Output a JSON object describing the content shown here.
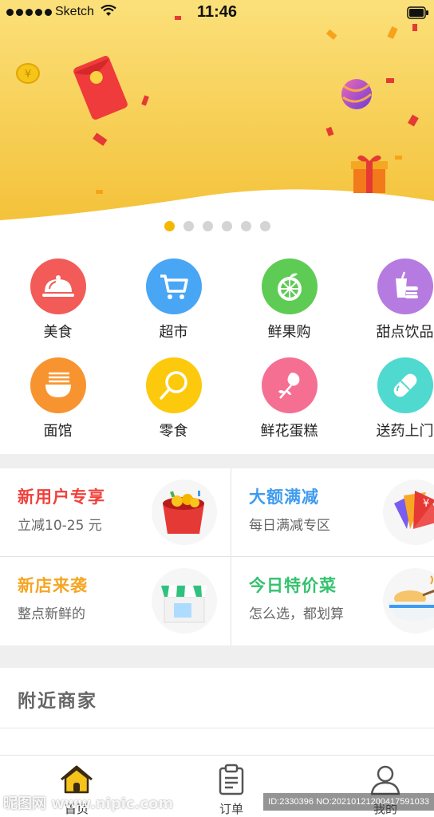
{
  "status_bar": {
    "carrier": "Sketch",
    "time": "11:46"
  },
  "banner": {
    "slide_count": 6,
    "active_index": 0
  },
  "categories": [
    {
      "label": "美食",
      "icon": "food-cloche-icon",
      "color": "#f25b58"
    },
    {
      "label": "超市",
      "icon": "shopping-cart-icon",
      "color": "#48a6f5"
    },
    {
      "label": "鲜果购",
      "icon": "fruit-icon",
      "color": "#5ecb55"
    },
    {
      "label": "甜点饮品",
      "icon": "dessert-drink-icon",
      "color": "#b67be0"
    },
    {
      "label": "面馆",
      "icon": "noodle-bowl-icon",
      "color": "#f7942f"
    },
    {
      "label": "零食",
      "icon": "lollipop-icon",
      "color": "#fcc90d"
    },
    {
      "label": "鲜花蛋糕",
      "icon": "flower-icon",
      "color": "#f56f92"
    },
    {
      "label": "送药上门",
      "icon": "pill-icon",
      "color": "#4fd9cf"
    }
  ],
  "promos": [
    {
      "title": "新用户专享",
      "subtitle": "立减10-25 元",
      "color": "#f0413b",
      "icon": "red-envelope-icon"
    },
    {
      "title": "大额满减",
      "subtitle": "每日满减专区",
      "color": "#3f9bef",
      "icon": "coupon-fan-icon"
    },
    {
      "title": "新店来袭",
      "subtitle": "整点新鲜的",
      "color": "#f5a623",
      "icon": "storefront-icon"
    },
    {
      "title": "今日特价菜",
      "subtitle": "怎么选，都划算",
      "color": "#33c26d",
      "icon": "dish-bowl-icon"
    }
  ],
  "nearby": {
    "title": "附近商家"
  },
  "tabs": [
    {
      "label": "首页",
      "icon": "home-icon",
      "active": true
    },
    {
      "label": "订单",
      "icon": "clipboard-icon",
      "active": false
    },
    {
      "label": "我的",
      "icon": "user-icon",
      "active": false
    }
  ],
  "watermark": {
    "left": "昵图网 www.nipic.com",
    "right": "ID:2330396 NO:20210121200417591033"
  }
}
